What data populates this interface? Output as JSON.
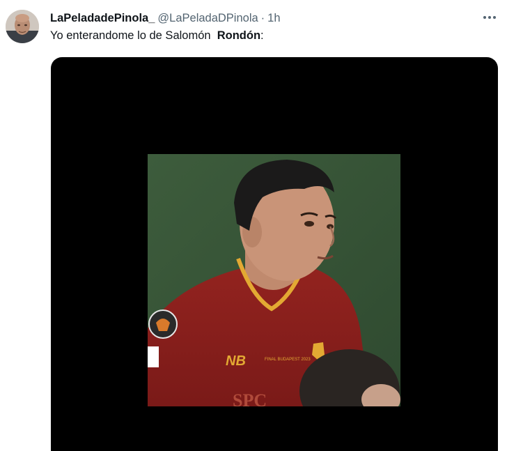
{
  "tweet": {
    "display_name": "LaPeladadePinola_",
    "handle": "@LaPeladaDPinola",
    "separator": "·",
    "timestamp": "1h",
    "text_prefix": "Yo enterandome lo de Salomón  ",
    "text_bold": "Rondón",
    "text_suffix": ":",
    "more_icon": "more-horizontal-icon",
    "avatar_icon": "avatar"
  },
  "media": {
    "jersey_sponsor_partial": "SPC",
    "jersey_badge_text": "FINAL BUDAPEST 2023"
  },
  "colors": {
    "text_primary": "#0f1419",
    "text_secondary": "#536471",
    "media_background": "#000000",
    "jersey": "#8c1f1d",
    "collar": "#e3a933",
    "pitch": "#3b5a39"
  }
}
